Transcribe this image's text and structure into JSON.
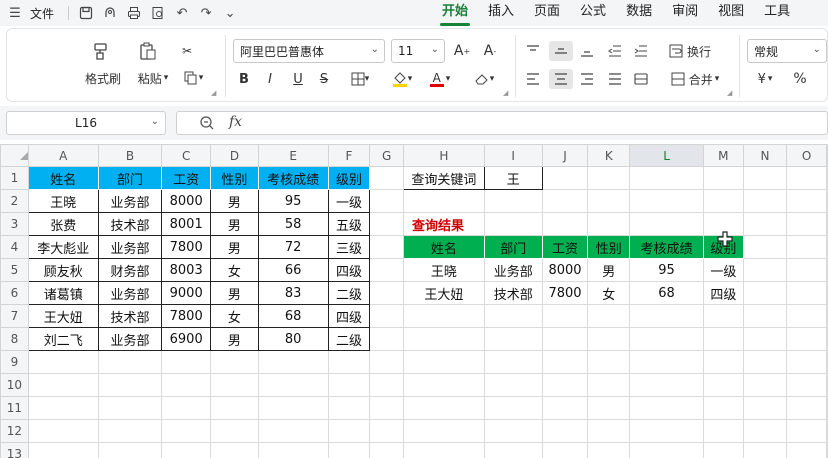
{
  "menubar": {
    "file": "文件",
    "icons": [
      "menu-icon",
      "save-icon",
      "cloud-icon",
      "print-icon",
      "preview-icon",
      "undo-icon",
      "redo-icon",
      "more-icon"
    ]
  },
  "tabs": [
    "开始",
    "插入",
    "页面",
    "公式",
    "数据",
    "审阅",
    "视图",
    "工具"
  ],
  "ribbon": {
    "format_painter": "格式刷",
    "paste": "粘贴",
    "font_name": "阿里巴巴普惠体",
    "font_size": "11",
    "wrap": "换行",
    "merge": "合并",
    "number_format": "常规",
    "currency": "¥",
    "percent": "%",
    "bold": "B",
    "italic": "I",
    "underline": "U",
    "strike": "S",
    "grow": "A",
    "shrink": "A",
    "font_a": "A"
  },
  "formula": {
    "name_box": "L16",
    "value": ""
  },
  "columns": [
    "A",
    "B",
    "C",
    "D",
    "E",
    "F",
    "G",
    "H",
    "I",
    "J",
    "K",
    "L",
    "M",
    "N",
    "O"
  ],
  "rows": [
    "1",
    "2",
    "3",
    "4",
    "5",
    "6",
    "7",
    "8",
    "9",
    "10",
    "11",
    "12",
    "13"
  ],
  "source_table": {
    "headers": [
      "姓名",
      "部门",
      "工资",
      "性别",
      "考核成绩",
      "级别"
    ],
    "rows": [
      [
        "王晓",
        "业务部",
        "8000",
        "男",
        "95",
        "一级"
      ],
      [
        "张费",
        "技术部",
        "8001",
        "男",
        "58",
        "五级"
      ],
      [
        "李大彪业",
        "业务部",
        "7800",
        "男",
        "72",
        "三级"
      ],
      [
        "顾友秋",
        "财务部",
        "8003",
        "女",
        "66",
        "四级"
      ],
      [
        "诸葛镇",
        "业务部",
        "9000",
        "男",
        "83",
        "二级"
      ],
      [
        "王大妞",
        "技术部",
        "7800",
        "女",
        "68",
        "四级"
      ],
      [
        "刘二飞",
        "业务部",
        "6900",
        "男",
        "80",
        "二级"
      ]
    ]
  },
  "query": {
    "label": "查询关键词",
    "value": "王",
    "result_title": "查询结果"
  },
  "result_table": {
    "headers": [
      "姓名",
      "部门",
      "工资",
      "性别",
      "考核成绩",
      "级别"
    ],
    "rows": [
      [
        "王晓",
        "业务部",
        "8000",
        "男",
        "95",
        "一级"
      ],
      [
        "王大妞",
        "技术部",
        "7800",
        "女",
        "68",
        "四级"
      ]
    ]
  },
  "colors": {
    "accent": "#1a7f37",
    "source_header": "#00b0f0",
    "result_header": "#00b050",
    "result_title": "#d00000"
  }
}
